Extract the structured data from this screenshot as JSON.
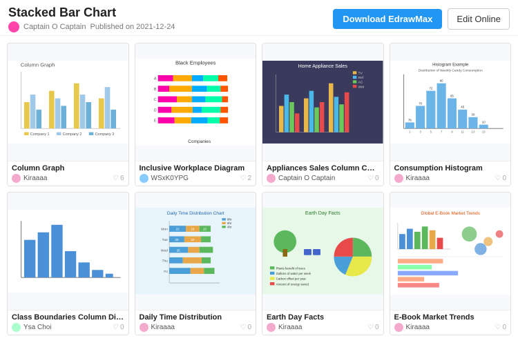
{
  "header": {
    "title": "Stacked Bar Chart",
    "author": "Captain O Captain",
    "published": "Published on 2021-12-24",
    "download_label": "Download EdrawMax",
    "edit_label": "Edit Online"
  },
  "cards": [
    {
      "id": "column-graph",
      "title": "Column Graph",
      "author": "Kiraaaa",
      "likes": "6",
      "avatar_color": "#f4aacc",
      "chart_type": "column_graph"
    },
    {
      "id": "inclusive-workplace",
      "title": "Inclusive Workplace Diagram",
      "author": "WSxK0YPG",
      "likes": "2",
      "avatar_color": "#88ccff",
      "chart_type": "bar_stacked_color"
    },
    {
      "id": "appliances-sales",
      "title": "Appliances Sales Column Chart",
      "author": "Captain O Captain",
      "likes": "0",
      "avatar_color": "#f4aacc",
      "chart_type": "appliances_chart"
    },
    {
      "id": "consumption-histogram",
      "title": "Consumption Histogram",
      "author": "Kiraaaa",
      "likes": "0",
      "avatar_color": "#f4aacc",
      "chart_type": "histogram"
    },
    {
      "id": "class-boundaries",
      "title": "Class Boundaries Column Diagram",
      "author": "Ysa Choi",
      "likes": "0",
      "avatar_color": "#aaffcc",
      "chart_type": "class_boundaries"
    },
    {
      "id": "daily-time",
      "title": "Daily Time Distribution",
      "author": "Kiraaaa",
      "likes": "0",
      "avatar_color": "#f4aacc",
      "chart_type": "daily_time"
    },
    {
      "id": "earth-day",
      "title": "Earth Day Facts",
      "author": "Kiraaaa",
      "likes": "0",
      "avatar_color": "#f4aacc",
      "chart_type": "earth_day"
    },
    {
      "id": "ebook-market",
      "title": "E-Book Market Trends",
      "author": "Kiraaaa",
      "likes": "0",
      "avatar_color": "#f4aacc",
      "chart_type": "ebook_trends"
    }
  ]
}
